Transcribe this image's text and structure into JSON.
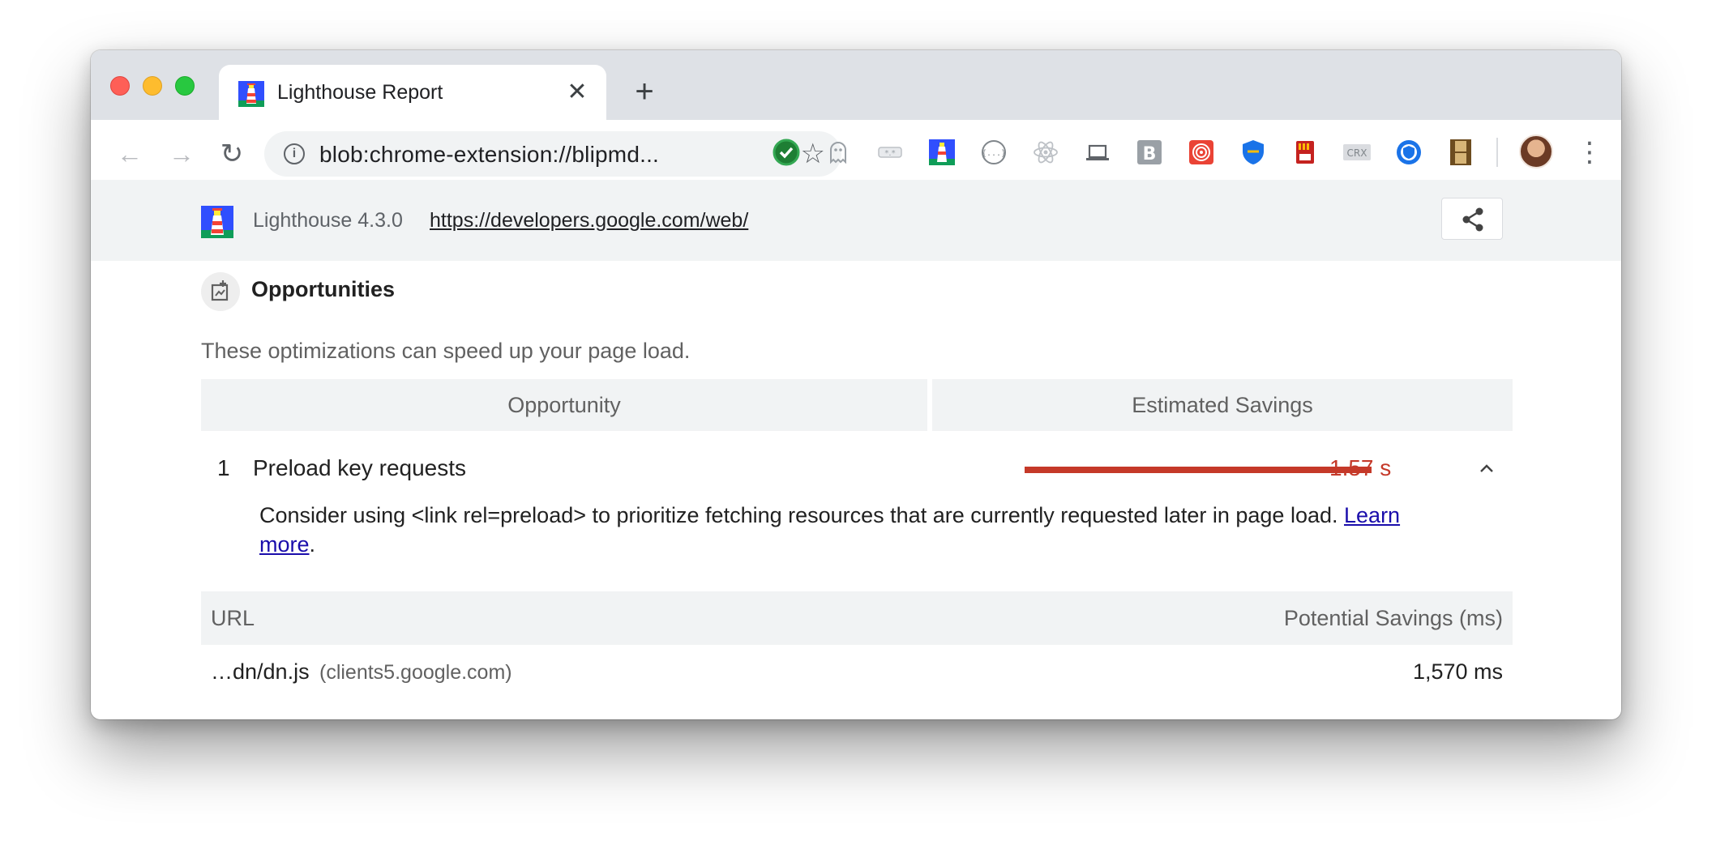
{
  "browser": {
    "tab": {
      "title": "Lighthouse Report",
      "close_label": "✕"
    },
    "new_tab_label": "+",
    "toolbar": {
      "back_label": "←",
      "forward_label": "→",
      "reload_label": "↻",
      "info_label": "i",
      "url": "blob:chrome-extension://blipmd...",
      "bookmark_label": "☆",
      "menu_label": "⋮"
    },
    "extensions": [
      {
        "icon": "checkmark-extension-icon",
        "color": "#34a853"
      },
      {
        "icon": "ghost-extension-icon",
        "color": "#9aa0a6"
      },
      {
        "icon": "password-extension-icon",
        "color": "#bdc1c6"
      },
      {
        "icon": "lighthouse-extension-icon",
        "color": "#3b5bdb"
      },
      {
        "icon": "json-extension-icon",
        "color": "#80868b"
      },
      {
        "icon": "react-extension-icon",
        "color": "#bdc1c6"
      },
      {
        "icon": "laptop-extension-icon",
        "color": "#5f6368"
      },
      {
        "icon": "b-extension-icon",
        "color": "#9aa0a6"
      },
      {
        "icon": "spiral-extension-icon",
        "color": "#ea4335"
      },
      {
        "icon": "shield-extension-icon",
        "color": "#1a73e8"
      },
      {
        "icon": "memory-card-extension-icon",
        "color": "#c5221f"
      },
      {
        "icon": "crx-extension-icon",
        "color": "#9aa0a6",
        "label": "CRX"
      },
      {
        "icon": "globe-shield-extension-icon",
        "color": "#1a73e8"
      },
      {
        "icon": "film-extension-icon",
        "color": "#b08850"
      }
    ]
  },
  "lighthouse": {
    "version": "Lighthouse 4.3.0",
    "url": "https://developers.google.com/web/",
    "section": {
      "title": "Opportunities",
      "description": "These optimizations can speed up your page load.",
      "col_opportunity": "Opportunity",
      "col_savings": "Estimated Savings"
    },
    "audit": {
      "index": "1",
      "title": "Preload key requests",
      "savings_display": "1.57 s",
      "savings_fraction": 0.56,
      "description": "Consider using <link rel=preload> to prioritize fetching resources that are currently requested later in page load. ",
      "learn_more": "Learn more",
      "period": "."
    },
    "details": {
      "col_url": "URL",
      "col_savings": "Potential Savings (ms)",
      "rows": [
        {
          "path": "…dn/dn.js",
          "host": "(clients5.google.com)",
          "savings": "1,570 ms"
        }
      ]
    }
  },
  "colors": {
    "savings_red": "#c53929",
    "link_blue": "#1a0dab",
    "header_gray": "#f1f3f4"
  }
}
